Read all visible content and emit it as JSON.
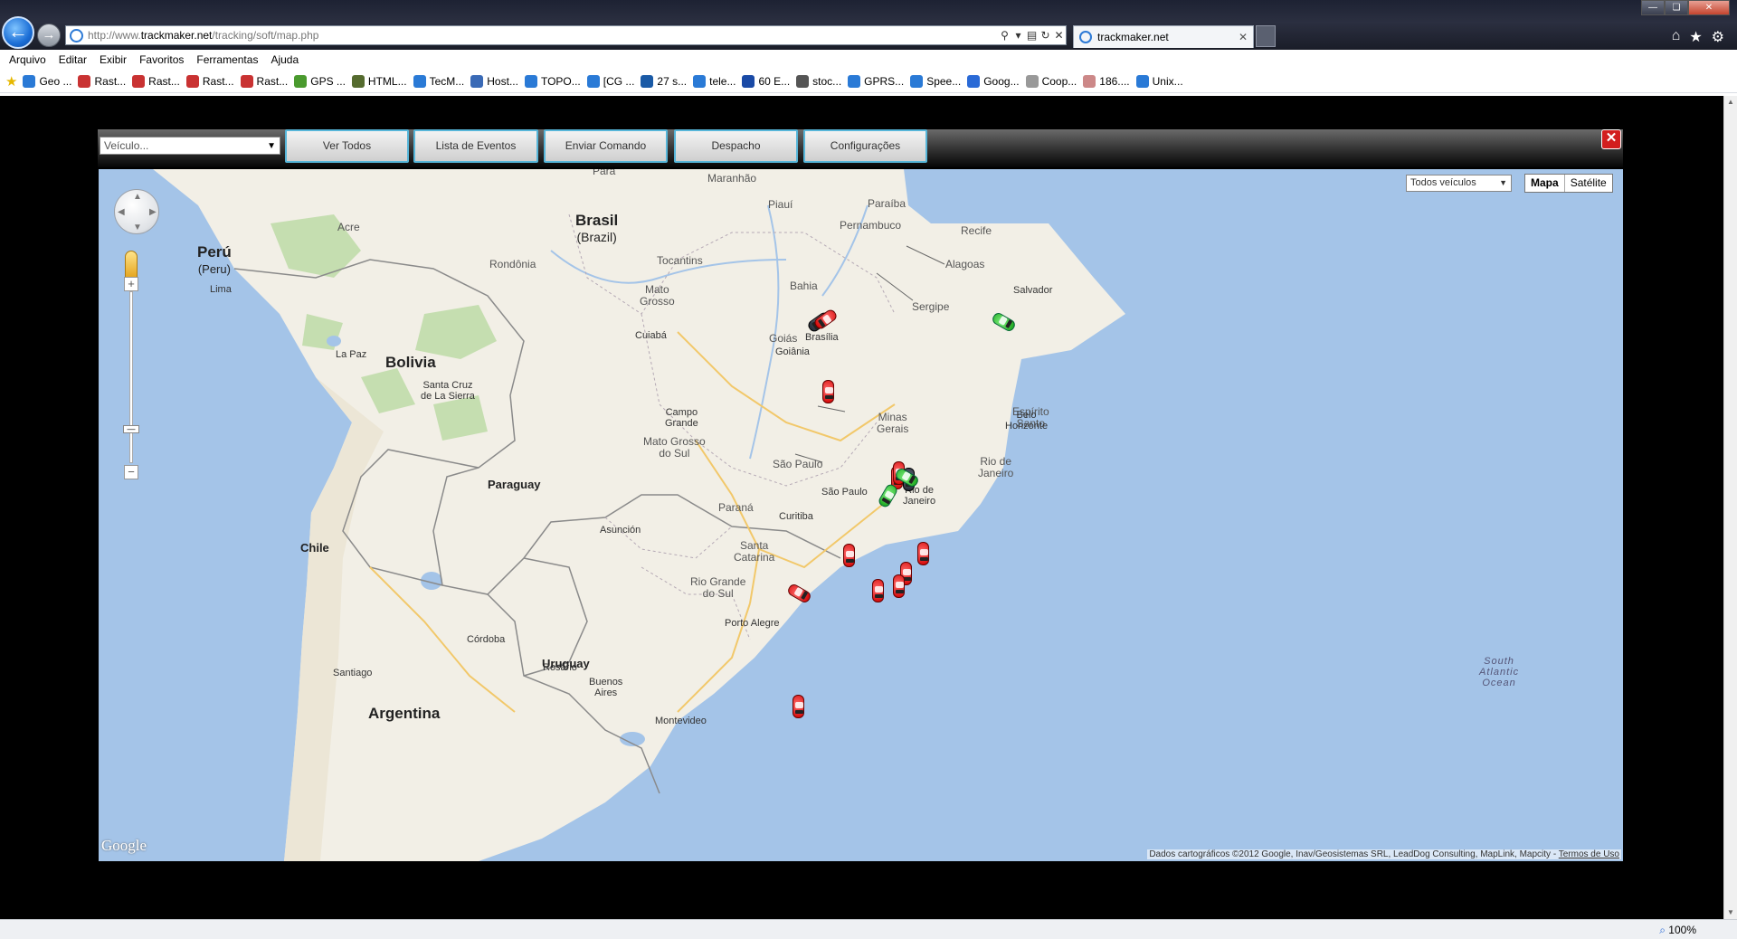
{
  "browser": {
    "url_prefix": "http://www.",
    "url_domain": "trackmaker.net",
    "url_path": "/tracking/soft/map.php",
    "tab_title": "trackmaker.net",
    "menu": [
      "Arquivo",
      "Editar",
      "Exibir",
      "Favoritos",
      "Ferramentas",
      "Ajuda"
    ],
    "favorites": [
      "Geo ...",
      "Rast...",
      "Rast...",
      "Rast...",
      "Rast...",
      "GPS ...",
      "HTML...",
      "TecM...",
      "Host...",
      "TOPO...",
      "[CG ...",
      "27 s...",
      "tele...",
      "60 E...",
      "stoc...",
      "GPRS...",
      "Spee...",
      "Goog...",
      "Coop...",
      "186....",
      "Unix..."
    ],
    "zoom": "100%"
  },
  "toolbar": {
    "vehicle_placeholder": "Veículo...",
    "buttons": [
      "Ver Todos",
      "Lista de Eventos",
      "Enviar Comando",
      "Despacho",
      "Configurações"
    ]
  },
  "map": {
    "filter": "Todos veículos",
    "type_map": "Mapa",
    "type_satellite": "Satélite",
    "google": "Google",
    "attribution": "Dados cartográficos ©2012 Google, Inav/Geosistemas SRL, LeadDog Consulting, MapLink, Mapcity - ",
    "terms": "Termos de Uso",
    "countries": {
      "brasil": "Brasil",
      "brazil": "(Brazil)",
      "peru": "Perú",
      "peru_en": "(Peru)",
      "bolivia": "Bolivia",
      "paraguay": "Paraguay",
      "chile": "Chile",
      "argentina": "Argentina",
      "uruguay": "Uruguay"
    },
    "states": {
      "para": "Pará",
      "maranhao": "Maranhão",
      "piaui": "Piauí",
      "paraiba": "Paraíba",
      "pernambuco": "Pernambuco",
      "alagoas": "Alagoas",
      "sergipe": "Sergipe",
      "bahia": "Bahia",
      "tocantins": "Tocantins",
      "acre": "Acre",
      "rondonia": "Rondônia",
      "mato_grosso": "Mato\nGrosso",
      "goias": "Goiás",
      "minas_gerais": "Minas\nGerais",
      "espirito_santo": "Espírito\nSanto",
      "rio_de_janeiro_state": "Rio de\nJaneiro",
      "mato_grosso_do_sul": "Mato Grosso\ndo Sul",
      "sao_paulo_state": "São Paulo",
      "parana": "Paraná",
      "santa_catarina": "Santa\nCatarina",
      "rio_grande_do_sul": "Rio Grande\ndo Sul"
    },
    "cities": {
      "recife": "Recife",
      "salvador": "Salvador",
      "brasilia": "Brasília",
      "goiania": "Goiânia",
      "cuiaba": "Cuiabá",
      "campo_grande": "Campo\nGrande",
      "belo_horizonte": "Belo\nHorizonte",
      "rio_de_janeiro": "Rio de\nJaneiro",
      "sao_paulo": "São Paulo",
      "curitiba": "Curitiba",
      "porto_alegre": "Porto Alegre",
      "lima": "Lima",
      "la_paz": "La Paz",
      "santa_cruz": "Santa Cruz\nde La Sierra",
      "asuncion": "Asunción",
      "cordoba": "Córdoba",
      "rosario": "Rosario",
      "santiago": "Santiago",
      "buenos_aires": "Buenos\nAires",
      "montevideo": "Montevideo"
    },
    "ocean": "South\nAtlantic\nOcean"
  }
}
